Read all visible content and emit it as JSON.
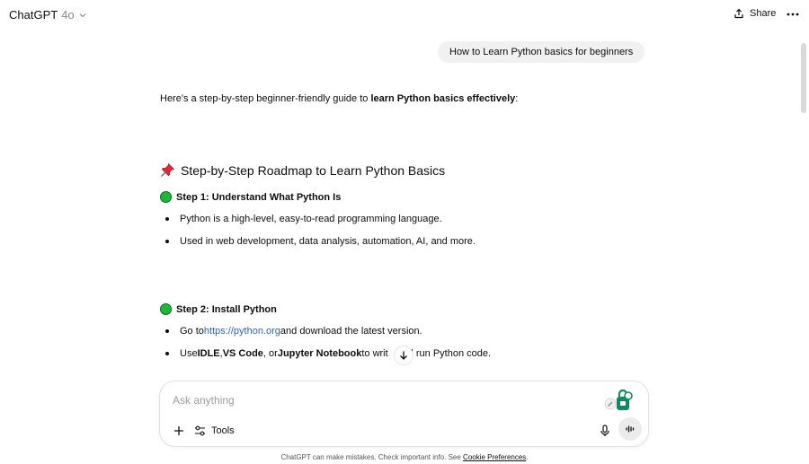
{
  "header": {
    "model_name": "ChatGPT",
    "model_version": "4o",
    "share_label": "Share"
  },
  "conversation": {
    "user_message": "How to Learn Python basics for beginners",
    "intro_prefix": "Here's a step-by-step beginner-friendly guide to ",
    "intro_bold": "learn Python basics effectively",
    "intro_suffix": ":",
    "heading_icon": "pushpin-icon",
    "heading": "Step-by-Step Roadmap to Learn Python Basics",
    "step1": {
      "title": "Step 1: Understand What Python Is",
      "bullets": [
        "Python is a high-level, easy-to-read programming language.",
        "Used in web development, data analysis, automation, AI, and more."
      ]
    },
    "step2": {
      "title": "Step 2: Install Python",
      "bullet1_prefix": "Go to ",
      "bullet1_link": "https://python.org",
      "bullet1_suffix": " and download the latest version.",
      "bullet2_prefix": "Use ",
      "bullet2_b1": "IDLE",
      "bullet2_sep1": ", ",
      "bullet2_b2": "VS Code",
      "bullet2_sep2": ", or ",
      "bullet2_b3": "Jupyter Notebook",
      "bullet2_suffix_a": " to writ",
      "bullet2_suffix_b": "d run Python code."
    }
  },
  "composer": {
    "placeholder": "Ask anything",
    "tools_label": "Tools"
  },
  "footer": {
    "text": "ChatGPT can make mistakes. Check important info. See ",
    "link": "Cookie Preferences",
    "end": "."
  },
  "colors": {
    "accent_green": "#1db83a",
    "link_blue": "#2e62c9",
    "bubble_bg": "#f1f1f1"
  }
}
